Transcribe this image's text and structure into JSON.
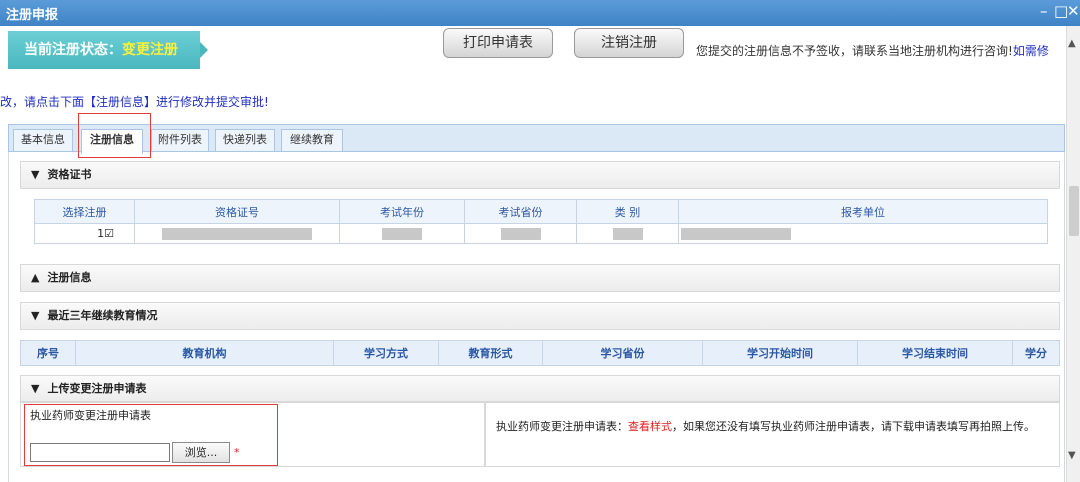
{
  "window": {
    "title": "注册申报",
    "minimize": "–",
    "maximize": "□",
    "close": "✕"
  },
  "status": {
    "label": "当前注册状态：",
    "value": "变更注册"
  },
  "buttons": {
    "print": "打印申请表",
    "cancel": "注销注册"
  },
  "notice": {
    "part1": "您提交的注册信息不予签收，请联系当地注册机构进行咨询!",
    "part2": "如需修",
    "part3": "改，请点击下面【注册信息】进行修改并提交审批!"
  },
  "tabs": [
    "基本信息",
    "注册信息",
    "附件列表",
    "快递列表",
    "继续教育"
  ],
  "sections": {
    "cert": "资格证书",
    "reg": "注册信息",
    "edu": "最近三年继续教育情况",
    "upload": "上传变更注册申请表"
  },
  "section_arrows": {
    "collapsed": "▲",
    "expanded": "▼"
  },
  "cert_table": {
    "headers": [
      "选择注册",
      "资格证号",
      "考试年份",
      "考试省份",
      "类  别",
      "报考单位"
    ],
    "row": {
      "index": "1",
      "checkbox": "☑"
    }
  },
  "edu_table": {
    "headers": [
      "序号",
      "教育机构",
      "学习方式",
      "教育形式",
      "学习省份",
      "学习开始时间",
      "学习结束时间",
      "学分"
    ]
  },
  "upload": {
    "label": "执业药师变更注册申请表",
    "browse": "浏览...",
    "required": "*",
    "desc_prefix": "执业药师变更注册申请表：",
    "desc_link": "查看样式",
    "desc_suffix": "，如果您还没有填写执业药师注册申请表，请下载申请表填写再拍照上传。"
  },
  "scrollbar": {
    "up": "▲",
    "down": "▼"
  }
}
